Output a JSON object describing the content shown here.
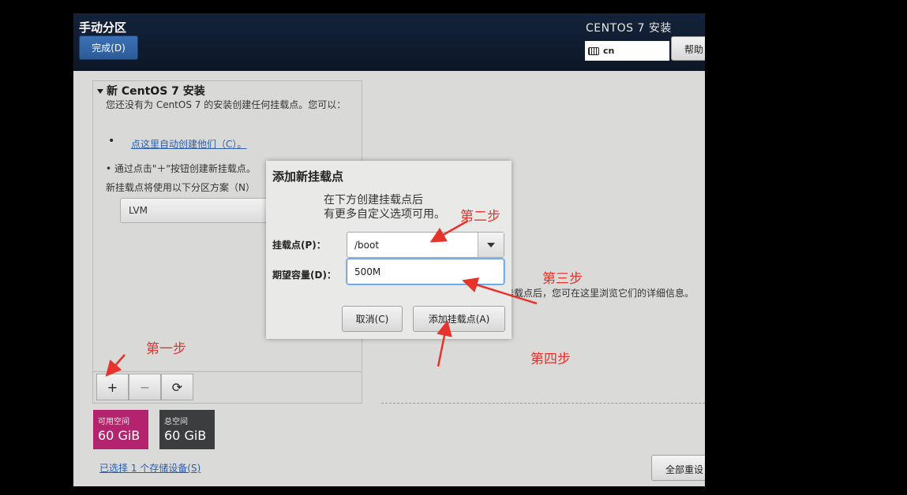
{
  "header": {
    "title": "手动分区",
    "done_label": "完成(D)",
    "install_title": "CENTOS 7 安装",
    "keyboard_layout": "cn",
    "help_label": "帮助"
  },
  "left_panel": {
    "section_title": "新 CentOS 7 安装",
    "description": "您还没有为 CentOS 7 的安装创建任何挂载点。您可以：",
    "bullet": "•",
    "auto_create_link": "点这里自动创建他们（C）。",
    "manual_hint": "• 通过点击\"＋\"按钮创建新挂载点。",
    "scheme_label": "新挂载点将使用以下分区方案（N）",
    "scheme_value": "LVM",
    "add_symbol": "+",
    "remove_symbol": "−",
    "refresh_symbol": "⟳"
  },
  "right_panel": {
    "detail_hint": "挂载点后，您可在这里浏览它们的详细信息。",
    "reset_label": "全部重设"
  },
  "storage": {
    "available_label": "可用空间",
    "available_value": "60 GiB",
    "total_label": "总空间",
    "total_value": "60 GiB",
    "selected_link": "已选择 1 个存储设备(S)"
  },
  "dialog": {
    "title": "添加新挂载点",
    "description_line1": "在下方创建挂载点后",
    "description_line2": "有更多自定义选项可用。",
    "mount_label": "挂载点(P)：",
    "mount_value": "/boot",
    "size_label": "期望容量(D)：",
    "size_value": "500M",
    "cancel_label": "取消(C)",
    "add_label": "添加挂载点(A)"
  },
  "annotations": {
    "step1": "第一步",
    "step2": "第二步",
    "step3": "第三步",
    "step4": "第四步",
    "color": "#e8322c"
  },
  "colors": {
    "accent": "#2d5b98",
    "available_bg": "#b4246e",
    "total_bg": "#3b3d3e"
  }
}
